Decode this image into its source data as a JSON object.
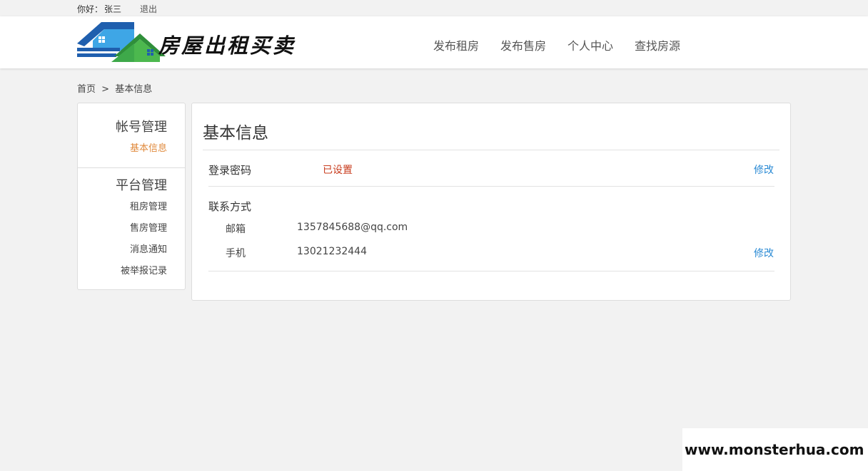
{
  "topbar": {
    "greeting": "你好：",
    "username": "张三",
    "logout": "退出"
  },
  "logo": {
    "text": "房屋出租买卖"
  },
  "nav": [
    {
      "label": "发布租房"
    },
    {
      "label": "发布售房"
    },
    {
      "label": "个人中心"
    },
    {
      "label": "查找房源"
    }
  ],
  "breadcrumb": {
    "home": "首页",
    "separator": ">",
    "current": "基本信息"
  },
  "sidebar": {
    "account": {
      "title": "帐号管理",
      "items": [
        {
          "label": "基本信息"
        }
      ]
    },
    "platform": {
      "title": "平台管理",
      "items": [
        {
          "label": "租房管理"
        },
        {
          "label": "售房管理"
        },
        {
          "label": "消息通知"
        },
        {
          "label": "被举报记录"
        }
      ]
    }
  },
  "main": {
    "title": "基本信息",
    "password": {
      "label": "登录密码",
      "status": "已设置",
      "edit": "修改"
    },
    "contact": {
      "label": "联系方式",
      "email_label": "邮箱",
      "email": "1357845688@qq.com",
      "phone_label": "手机",
      "phone": "13021232444",
      "edit": "修改"
    }
  },
  "colors": {
    "accent_orange": "#e08a3c",
    "status_red": "#c83c1e",
    "link_blue": "#2a8ad4"
  },
  "watermark": "www.monsterhua.com"
}
